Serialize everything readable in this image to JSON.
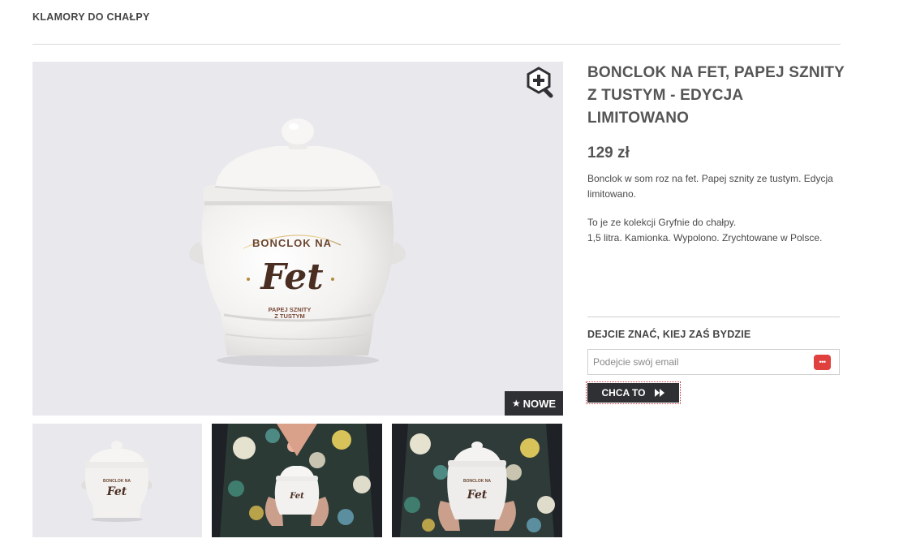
{
  "breadcrumb": {
    "label": "KLAMORY DO CHAŁPY"
  },
  "product": {
    "title": "BONCLOK NA FET, PAPEJ SZNITY Z TUSTYM - EDYCJA LIMITOWANO",
    "price": "129 zł",
    "description_1": "Bonclok w som roz na fet. Papej sznity ze tustym. Edycja limitowano.",
    "description_2_line_1": "To je ze kolekcji Gryfnie do chałpy.",
    "description_2_line_2": "1,5 litra. Kamionka. Wypolono. Zrychtowane w Polsce."
  },
  "image": {
    "badge_label": "NOWE",
    "badge_icon": "star-icon",
    "zoom_icon": "zoom-in-icon",
    "jar_text_top": "BONCLOK NA",
    "jar_text_main": "Fet",
    "jar_text_bottom_1": "PAPEJ SZNITY",
    "jar_text_bottom_2": "Z TUSTYM"
  },
  "notify": {
    "heading": "DEJCIE ZNAĆ, KIEJ ZAŚ BYDZIE",
    "email_placeholder": "Podejcie swój email",
    "email_value": "",
    "password_manager_icon": "password-manager-icon",
    "submit_label": "CHCA TO",
    "submit_icon": "fast-forward-icon"
  },
  "thumbnails": [
    {
      "name": "thumbnail-jar-studio"
    },
    {
      "name": "thumbnail-jar-held-1"
    },
    {
      "name": "thumbnail-jar-held-2"
    }
  ],
  "colors": {
    "dark": "#2f3033",
    "background_image": "#e9e8ec",
    "accent_red": "#e0413f",
    "jar_gold": "#b38a3a",
    "jar_brown": "#5a3a2a"
  }
}
